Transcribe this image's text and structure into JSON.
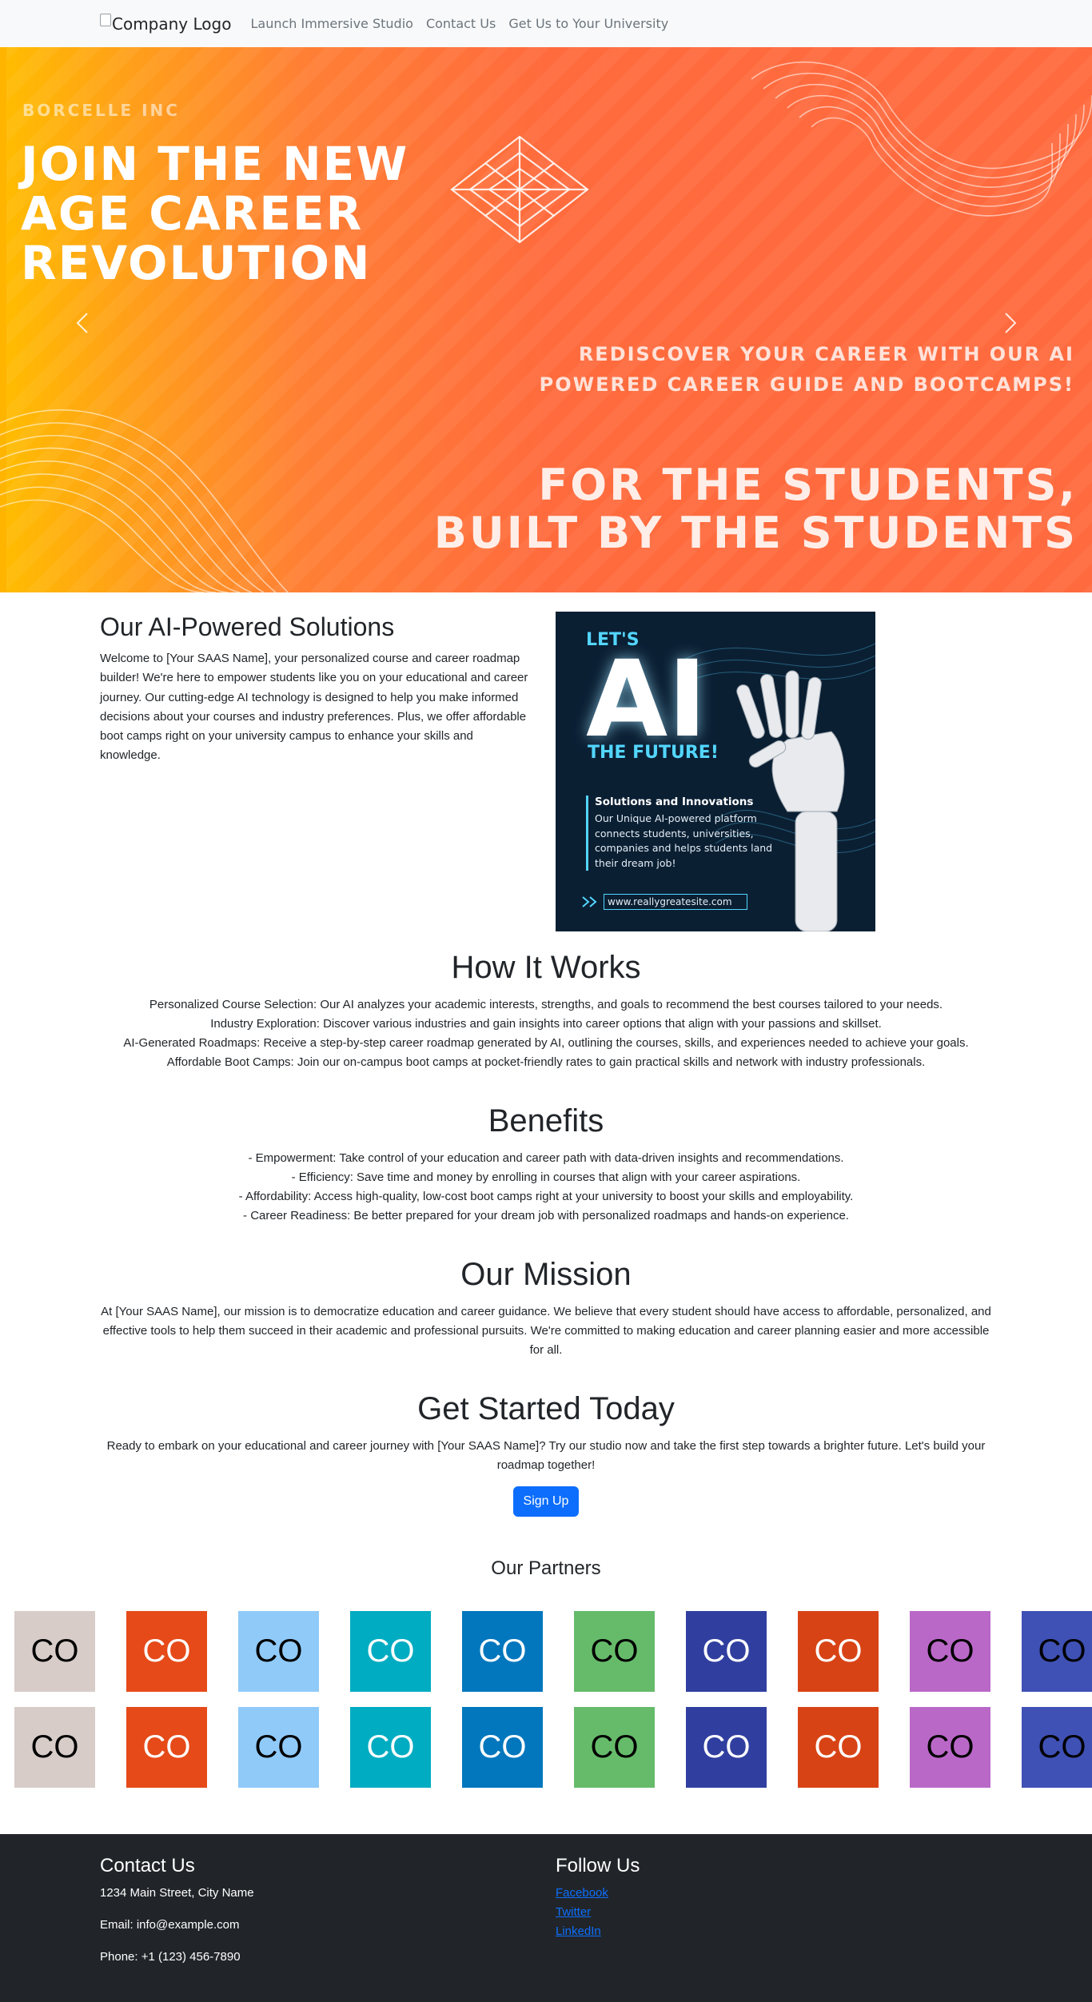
{
  "nav": {
    "logo_alt": "Company Logo",
    "links": [
      "Launch Immersive Studio",
      "Contact Us",
      "Get Us to Your University"
    ]
  },
  "hero": {
    "eyebrow": "BORCELLE INC",
    "title": "JOIN THE NEW AGE CAREER REVOLUTION",
    "subtitle": "REDISCOVER YOUR CAREER WITH OUR AI POWERED CAREER GUIDE AND BOOTCAMPS!",
    "tagline": "FOR THE STUDENTS, BUILT BY THE STUDENTS",
    "prev_icon": "chevron-left-icon",
    "next_icon": "chevron-right-icon"
  },
  "solutions": {
    "title": "Our AI-Powered Solutions",
    "text": "Welcome to [Your SAAS Name], your personalized course and career roadmap builder! We're here to empower students like you on your educational and career journey. Our cutting-edge AI technology is designed to help you make informed decisions about your courses and industry preferences. Plus, we offer affordable boot camps right on your university campus to enhance your skills and knowledge.",
    "promo": {
      "lets": "LET'S",
      "ai": "AI",
      "future": "THE FUTURE!",
      "box_title": "Solutions and Innovations",
      "box_text": "Our Unique AI-powered platform connects students, universities, companies and helps students land their dream job!",
      "url": "www.reallygreatesite.com"
    }
  },
  "how_it_works": {
    "title": "How It Works",
    "lines": [
      "Personalized Course Selection: Our AI analyzes your academic interests, strengths, and goals to recommend the best courses tailored to your needs.",
      "Industry Exploration: Discover various industries and gain insights into career options that align with your passions and skillset.",
      "AI-Generated Roadmaps: Receive a step-by-step career roadmap generated by AI, outlining the courses, skills, and experiences needed to achieve your goals.",
      "Affordable Boot Camps: Join our on-campus boot camps at pocket-friendly rates to gain practical skills and network with industry professionals."
    ]
  },
  "benefits": {
    "title": "Benefits",
    "lines": [
      "- Empowerment: Take control of your education and career path with data-driven insights and recommendations.",
      "- Efficiency: Save time and money by enrolling in courses that align with your career aspirations.",
      "- Affordability: Access high-quality, low-cost boot camps right at your university to boost your skills and employability.",
      "- Career Readiness: Be better prepared for your dream job with personalized roadmaps and hands-on experience."
    ]
  },
  "mission": {
    "title": "Our Mission",
    "text": "At [Your SAAS Name], our mission is to democratize education and career guidance. We believe that every student should have access to affordable, personalized, and effective tools to help them succeed in their academic and professional pursuits. We're committed to making education and career planning easier and more accessible for all."
  },
  "get_started": {
    "title": "Get Started Today",
    "text": "Ready to embark on your educational and career journey with [Your SAAS Name]? Try our studio now and take the first step towards a brighter future. Let's build your roadmap together!",
    "button": "Sign Up"
  },
  "partners": {
    "title": "Our Partners",
    "tile_label": "CO",
    "rows": 2,
    "colors": [
      {
        "bg": "#d7ccc8",
        "fg": "#000000"
      },
      {
        "bg": "#e64a19",
        "fg": "#ffffff"
      },
      {
        "bg": "#90caf9",
        "fg": "#000000"
      },
      {
        "bg": "#00acc1",
        "fg": "#ffffff"
      },
      {
        "bg": "#0277bd",
        "fg": "#ffffff"
      },
      {
        "bg": "#66bb6a",
        "fg": "#000000"
      },
      {
        "bg": "#303f9f",
        "fg": "#ffffff"
      },
      {
        "bg": "#d84315",
        "fg": "#ffffff"
      },
      {
        "bg": "#ba68c8",
        "fg": "#000000"
      },
      {
        "bg": "#3f51b5",
        "fg": "#000000"
      }
    ]
  },
  "footer": {
    "contact_title": "Contact Us",
    "address": "1234 Main Street, City Name",
    "email": "Email: info@example.com",
    "phone": "Phone: +1 (123) 456-7890",
    "follow_title": "Follow Us",
    "social": [
      "Facebook",
      "Twitter",
      "LinkedIn"
    ]
  },
  "colors": {
    "navbar_bg": "#f8f9fa",
    "primary": "#0d6efd",
    "footer_bg": "#212529",
    "hero_orange": "#ff6b3d",
    "hero_yellow": "#ffbd00",
    "promo_bg": "#0b1f33",
    "promo_accent": "#53d6ff"
  }
}
